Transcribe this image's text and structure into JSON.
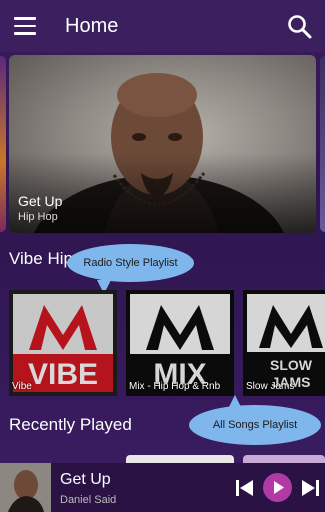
{
  "header": {
    "title": "Home"
  },
  "hero": {
    "title": "Get Up",
    "subtitle": "Hip Hop"
  },
  "sections": {
    "vibe": "Vibe Hip",
    "recent": "Recently Played"
  },
  "tooltips": {
    "radio": "Radio Style Playlist",
    "songs": "All Songs Playlist"
  },
  "albums": [
    {
      "caption": "Vibe",
      "art_word": "VIBE",
      "art_color": "#b6141c"
    },
    {
      "caption": "Mix - Hip Hop & Rnb",
      "art_word": "MIX",
      "art_color": "#d9d9d9"
    },
    {
      "caption": "Slow Jams",
      "art_word": "SLOW JAMS",
      "art_color": "#d9d9d9"
    }
  ],
  "player": {
    "title": "Get Up",
    "artist": "Daniel Said"
  },
  "colors": {
    "accent": "#b23aa6",
    "topbar": "#3b1f5e",
    "tooltip": "#7fb6ec"
  },
  "icons": [
    "menu-icon",
    "search-icon",
    "skip-previous-icon",
    "play-icon",
    "skip-next-icon"
  ]
}
